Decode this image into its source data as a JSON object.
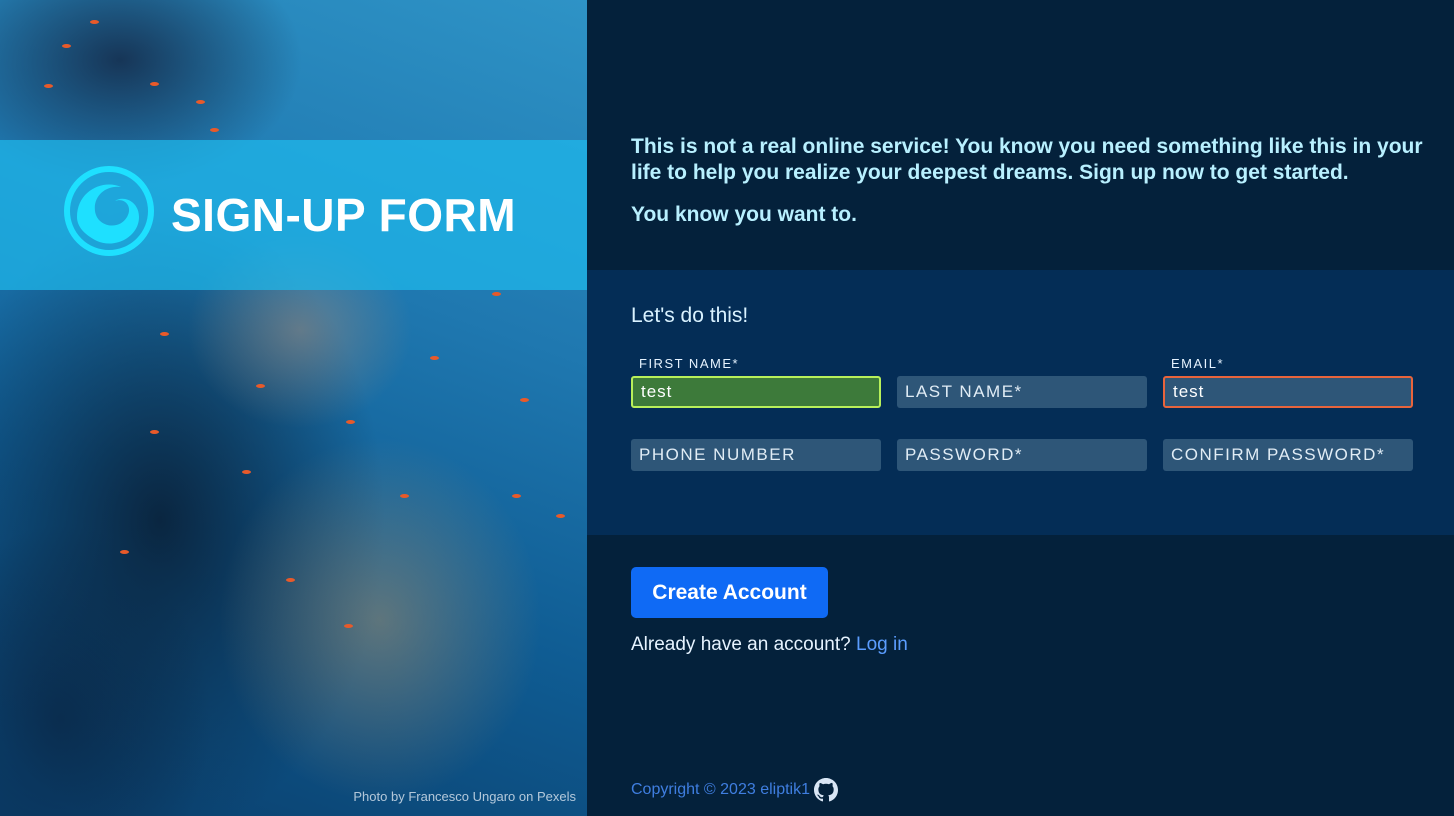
{
  "banner": {
    "title": "SIGN-UP FORM",
    "logo_icon": "wave-swirl-logo"
  },
  "photo_credit": {
    "prefix": "Photo by ",
    "author": "Francesco Ungaro",
    "middle": " on ",
    "source": "Pexels"
  },
  "intro": {
    "paragraph1": "This is not a real online service! You know you need something like this in your life to help you realize your deepest dreams. Sign up now to get started.",
    "paragraph2": "You know you want to."
  },
  "form": {
    "heading": "Let's do this!",
    "first_name": {
      "label": "FIRST NAME*",
      "value": "test",
      "state": "valid"
    },
    "last_name": {
      "placeholder": "LAST NAME*",
      "value": ""
    },
    "email": {
      "label": "EMAIL*",
      "value": "test",
      "state": "invalid"
    },
    "phone": {
      "placeholder": "PHONE NUMBER",
      "value": ""
    },
    "password": {
      "placeholder": "PASSWORD*",
      "value": ""
    },
    "confirm_password": {
      "placeholder": "CONFIRM PASSWORD*",
      "value": ""
    }
  },
  "actions": {
    "create_label": "Create Account",
    "login_prompt": "Already have an account? ",
    "login_link": "Log in"
  },
  "footer": {
    "copyright": "Copyright © 2023 eliptik1",
    "github_icon": "github-icon"
  },
  "colors": {
    "background": "#04213b",
    "form_area": "#042d56",
    "accent_button": "#0f6af5",
    "intro_text": "#b8f0ff",
    "valid_border": "#b8f05a",
    "invalid_border": "#e8643c",
    "banner": "#1eb9eb"
  }
}
